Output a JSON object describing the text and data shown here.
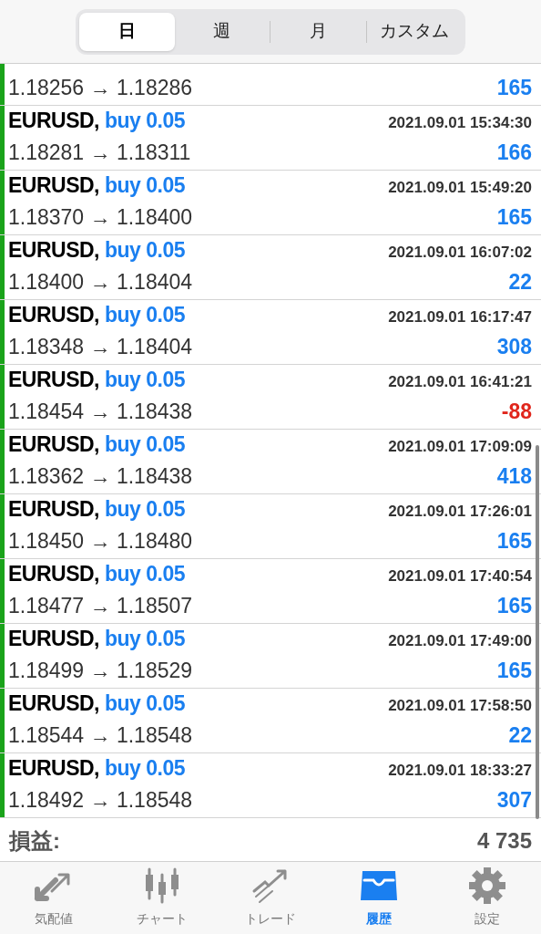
{
  "segments": [
    {
      "label": "日",
      "selected": true
    },
    {
      "label": "週",
      "selected": false
    },
    {
      "label": "月",
      "selected": false
    },
    {
      "label": "カスタム",
      "selected": false
    }
  ],
  "deals": [
    {
      "prices": "1.18256 → 1.18286",
      "profit": "165",
      "negative": false
    },
    {
      "symbol": "EURUSD,",
      "order": "buy 0.05",
      "time": "2021.09.01 15:34:30",
      "prices": "1.18281 → 1.18311",
      "profit": "166",
      "negative": false
    },
    {
      "symbol": "EURUSD,",
      "order": "buy 0.05",
      "time": "2021.09.01 15:49:20",
      "prices": "1.18370 → 1.18400",
      "profit": "165",
      "negative": false
    },
    {
      "symbol": "EURUSD,",
      "order": "buy 0.05",
      "time": "2021.09.01 16:07:02",
      "prices": "1.18400 → 1.18404",
      "profit": "22",
      "negative": false
    },
    {
      "symbol": "EURUSD,",
      "order": "buy 0.05",
      "time": "2021.09.01 16:17:47",
      "prices": "1.18348 → 1.18404",
      "profit": "308",
      "negative": false
    },
    {
      "symbol": "EURUSD,",
      "order": "buy 0.05",
      "time": "2021.09.01 16:41:21",
      "prices": "1.18454 → 1.18438",
      "profit": "-88",
      "negative": true
    },
    {
      "symbol": "EURUSD,",
      "order": "buy 0.05",
      "time": "2021.09.01 17:09:09",
      "prices": "1.18362 → 1.18438",
      "profit": "418",
      "negative": false
    },
    {
      "symbol": "EURUSD,",
      "order": "buy 0.05",
      "time": "2021.09.01 17:26:01",
      "prices": "1.18450 → 1.18480",
      "profit": "165",
      "negative": false
    },
    {
      "symbol": "EURUSD,",
      "order": "buy 0.05",
      "time": "2021.09.01 17:40:54",
      "prices": "1.18477 → 1.18507",
      "profit": "165",
      "negative": false
    },
    {
      "symbol": "EURUSD,",
      "order": "buy 0.05",
      "time": "2021.09.01 17:49:00",
      "prices": "1.18499 → 1.18529",
      "profit": "165",
      "negative": false
    },
    {
      "symbol": "EURUSD,",
      "order": "buy 0.05",
      "time": "2021.09.01 17:58:50",
      "prices": "1.18544 → 1.18548",
      "profit": "22",
      "negative": false
    },
    {
      "symbol": "EURUSD,",
      "order": "buy 0.05",
      "time": "2021.09.01 18:33:27",
      "prices": "1.18492 → 1.18548",
      "profit": "307",
      "negative": false
    }
  ],
  "total": {
    "label": "損益:",
    "value": "4 735"
  },
  "tab_bar": [
    {
      "kind": "quotes",
      "label": "気配値",
      "selected": false
    },
    {
      "kind": "chart",
      "label": "チャート",
      "selected": false
    },
    {
      "kind": "trade",
      "label": "トレード",
      "selected": false
    },
    {
      "kind": "history",
      "label": "履歴",
      "selected": true
    },
    {
      "kind": "settings",
      "label": "設定",
      "selected": false
    }
  ]
}
